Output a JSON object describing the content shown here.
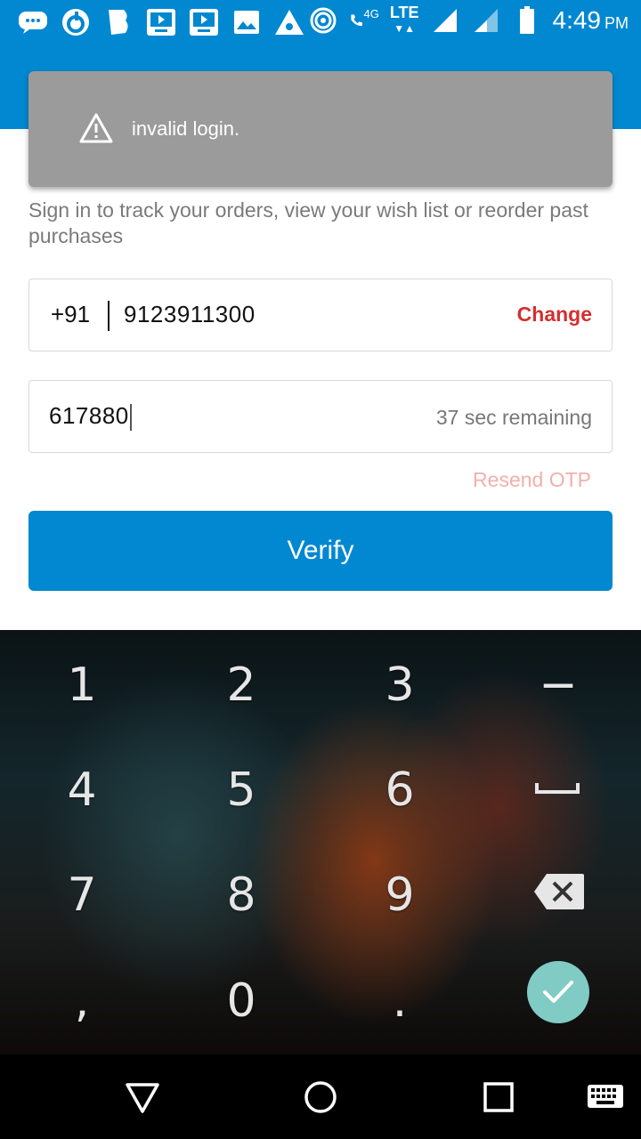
{
  "status_bar": {
    "time": "4:49",
    "ampm": "PM",
    "network_label": "LTE",
    "network_sub": "4G",
    "left_icons": [
      "chat-icon",
      "refresh-icon",
      "bookmark-icon",
      "video-icon",
      "video-icon",
      "image-icon",
      "app-icon"
    ],
    "right_icons": [
      "hotspot-icon",
      "call-icon",
      "signal-icon",
      "signal-icon",
      "battery-icon"
    ]
  },
  "toast": {
    "icon": "warning-icon",
    "message": "invalid login."
  },
  "login": {
    "subtitle": "Sign in to track your orders, view your wish list or reorder past purchases",
    "country_code": "+91",
    "phone_number": "9123911300",
    "change_label": "Change",
    "otp_value": "617880",
    "timer_text": "37 sec remaining",
    "resend_label": "Resend OTP",
    "verify_label": "Verify"
  },
  "keyboard": {
    "keys": [
      "1",
      "2",
      "3",
      "−",
      "4",
      "5",
      "6",
      "7",
      "8",
      "9",
      ",",
      "0",
      "."
    ],
    "icons": [
      "space-icon",
      "backspace-icon",
      "done-check-icon"
    ]
  },
  "colors": {
    "brand_blue": "#0288d1",
    "change_red": "#d32f2f",
    "resend_pink": "#f2b0ab",
    "toast_gray": "#9b9b9b",
    "ok_teal": "#80cbc4"
  },
  "nav_bar": {
    "icons": [
      "back-icon",
      "home-icon",
      "recents-icon",
      "keyboard-switch-icon"
    ]
  }
}
